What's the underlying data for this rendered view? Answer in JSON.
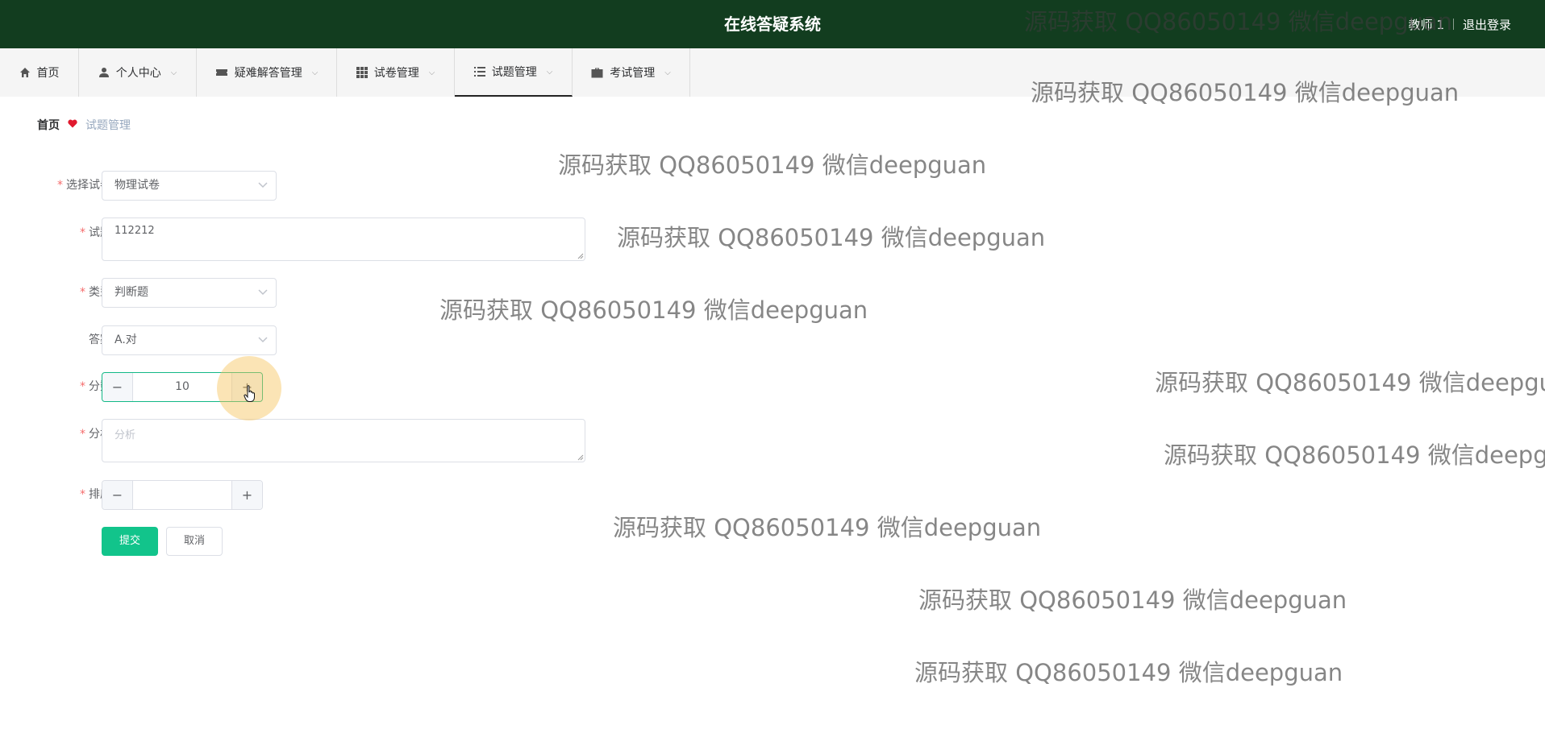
{
  "header": {
    "title": "在线答疑系统",
    "user": "教师 1",
    "logout": "退出登录"
  },
  "nav": [
    {
      "label": "首页",
      "icon": "home-icon"
    },
    {
      "label": "个人中心",
      "icon": "user-icon"
    },
    {
      "label": "疑难解答管理",
      "icon": "ticket-icon"
    },
    {
      "label": "试卷管理",
      "icon": "grid-icon"
    },
    {
      "label": "试题管理",
      "icon": "list-icon",
      "active": true
    },
    {
      "label": "考试管理",
      "icon": "briefcase-icon"
    }
  ],
  "breadcrumb": {
    "home": "首页",
    "current": "试题管理"
  },
  "form": {
    "paper": {
      "label": "选择试卷",
      "value": "物理试卷"
    },
    "question": {
      "label": "试题",
      "value": "112212"
    },
    "type": {
      "label": "类型",
      "value": "判断题"
    },
    "answer": {
      "label": "答案",
      "value": "A.对"
    },
    "score": {
      "label": "分数",
      "value": "10"
    },
    "analysis": {
      "label": "分析",
      "placeholder": "分析"
    },
    "order": {
      "label": "排序",
      "value": ""
    },
    "submit": "提交",
    "cancel": "取消"
  },
  "watermark": "源码获取 QQ86050149 微信deepguan",
  "colors": {
    "topbar": "#123d1f",
    "accent": "#12c48b",
    "required": "#f56c6c",
    "heart": "#e0192e"
  }
}
